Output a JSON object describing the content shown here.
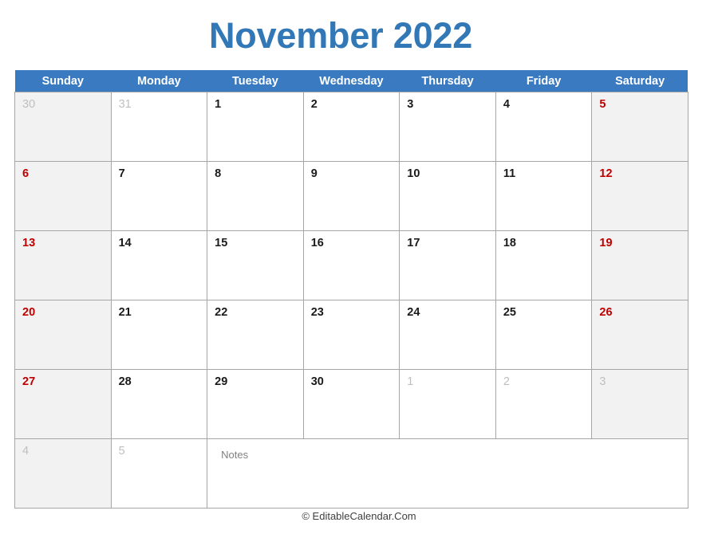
{
  "title": "November 2022",
  "theme": {
    "title_color": "#3278B6",
    "header_bg": "#3A7AC0",
    "header_text": "#FFFFFF",
    "weekend_bg": "#F2F2F2",
    "weekend_text": "#C00000",
    "weekday_text": "#1A1A1A",
    "muted_text": "#BFBFBF",
    "grid_line": "#A6A6A6",
    "notes_text": "#808080"
  },
  "weekdays": [
    "Sunday",
    "Monday",
    "Tuesday",
    "Wednesday",
    "Thursday",
    "Friday",
    "Saturday"
  ],
  "notes_label": "Notes",
  "footer": "© EditableCalendar.Com",
  "weeks": [
    [
      {
        "day": "30",
        "style": "muted",
        "weekend": true
      },
      {
        "day": "31",
        "style": "muted",
        "weekend": false
      },
      {
        "day": "1",
        "style": "normal",
        "weekend": false
      },
      {
        "day": "2",
        "style": "normal",
        "weekend": false
      },
      {
        "day": "3",
        "style": "normal",
        "weekend": false
      },
      {
        "day": "4",
        "style": "normal",
        "weekend": false
      },
      {
        "day": "5",
        "style": "red",
        "weekend": true
      }
    ],
    [
      {
        "day": "6",
        "style": "red",
        "weekend": true
      },
      {
        "day": "7",
        "style": "normal",
        "weekend": false
      },
      {
        "day": "8",
        "style": "normal",
        "weekend": false
      },
      {
        "day": "9",
        "style": "normal",
        "weekend": false
      },
      {
        "day": "10",
        "style": "normal",
        "weekend": false
      },
      {
        "day": "11",
        "style": "normal",
        "weekend": false
      },
      {
        "day": "12",
        "style": "red",
        "weekend": true
      }
    ],
    [
      {
        "day": "13",
        "style": "red",
        "weekend": true
      },
      {
        "day": "14",
        "style": "normal",
        "weekend": false
      },
      {
        "day": "15",
        "style": "normal",
        "weekend": false
      },
      {
        "day": "16",
        "style": "normal",
        "weekend": false
      },
      {
        "day": "17",
        "style": "normal",
        "weekend": false
      },
      {
        "day": "18",
        "style": "normal",
        "weekend": false
      },
      {
        "day": "19",
        "style": "red",
        "weekend": true
      }
    ],
    [
      {
        "day": "20",
        "style": "red",
        "weekend": true
      },
      {
        "day": "21",
        "style": "normal",
        "weekend": false
      },
      {
        "day": "22",
        "style": "normal",
        "weekend": false
      },
      {
        "day": "23",
        "style": "normal",
        "weekend": false
      },
      {
        "day": "24",
        "style": "normal",
        "weekend": false
      },
      {
        "day": "25",
        "style": "normal",
        "weekend": false
      },
      {
        "day": "26",
        "style": "red",
        "weekend": true
      }
    ],
    [
      {
        "day": "27",
        "style": "red",
        "weekend": true
      },
      {
        "day": "28",
        "style": "normal",
        "weekend": false
      },
      {
        "day": "29",
        "style": "normal",
        "weekend": false
      },
      {
        "day": "30",
        "style": "normal",
        "weekend": false
      },
      {
        "day": "1",
        "style": "muted",
        "weekend": false
      },
      {
        "day": "2",
        "style": "muted",
        "weekend": false
      },
      {
        "day": "3",
        "style": "muted",
        "weekend": true
      }
    ]
  ],
  "last_row": {
    "cells": [
      {
        "day": "4",
        "style": "muted",
        "weekend": true
      },
      {
        "day": "5",
        "style": "muted",
        "weekend": false
      }
    ],
    "notes_colspan": 5
  }
}
